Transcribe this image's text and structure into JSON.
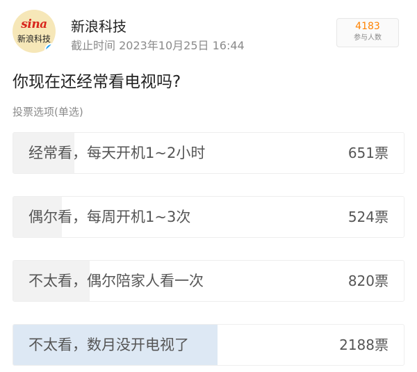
{
  "account": {
    "name": "新浪科技",
    "avatar_logo": "sina",
    "avatar_subtitle": "新浪科技",
    "verified_icon": "verified-check-icon"
  },
  "poll": {
    "deadline": "截止时间 2023年10月25日 16:44",
    "participants_count": "4183",
    "participants_label": "参与人数",
    "question": "你现在还经常看电视吗?",
    "type_label": "投票选项(单选)",
    "highlight_color": "#dde8f4",
    "options": [
      {
        "label": "经常看，每天开机1~2小时",
        "votes": "651票",
        "share": 0.156
      },
      {
        "label": "偶尔看，每周开机1~3次",
        "votes": "524票",
        "share": 0.125
      },
      {
        "label": "不太看，偶尔陪家人看一次",
        "votes": "820票",
        "share": 0.196
      },
      {
        "label": "不太看，数月没开电视了",
        "votes": "2188票",
        "share": 0.523
      }
    ]
  }
}
